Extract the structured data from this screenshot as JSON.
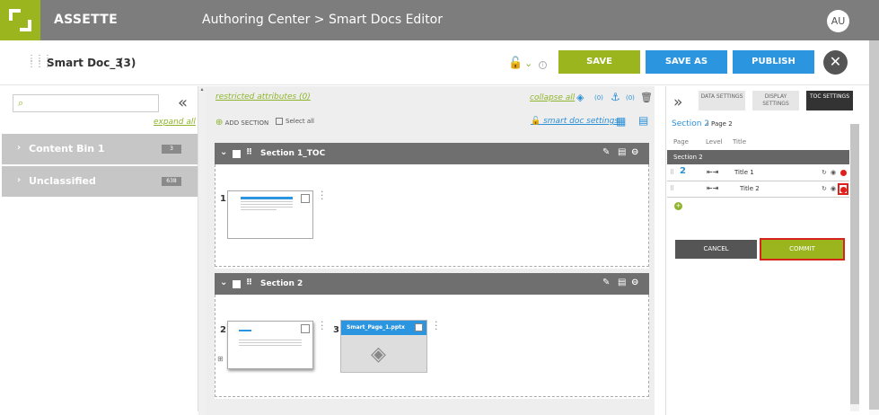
{
  "app": {
    "brand": "ASSETTE",
    "breadcrumb": "Authoring Center > Smart Docs Editor",
    "user_initials": "AU"
  },
  "toolbar": {
    "doc_title": "Smart Doc_3",
    "doc_count": "(3)",
    "save": "SAVE",
    "save_as": "SAVE AS",
    "publish": "PUBLISH",
    "close_glyph": "✕"
  },
  "colors": {
    "accent_green": "#9ab51e",
    "accent_blue": "#2b95e0",
    "highlight_red": "#e0201a",
    "header_gray": "#7d7d7d"
  },
  "left": {
    "search_placeholder": "",
    "expand_all": "expand all",
    "bins": [
      {
        "label": "Content Bin 1",
        "count": "3"
      },
      {
        "label": "Unclassified",
        "count": "638"
      }
    ]
  },
  "middle": {
    "restricted": "restricted attributes (0)",
    "collapse_all": "collapse all",
    "count_a": "(0)",
    "count_b": "(0)",
    "add_section": "ADD SECTION",
    "select_all": "Select all",
    "smart_doc_settings": "smart doc settings",
    "sections": [
      {
        "title": "Section 1_TOC",
        "pages": [
          {
            "num": "1"
          }
        ]
      },
      {
        "title": "Section 2",
        "pages": [
          {
            "num": "2"
          },
          {
            "num": "3",
            "name": "Smart_Page_1.pptx"
          }
        ]
      }
    ]
  },
  "right": {
    "tabs": [
      {
        "label": "DATA SETTINGS"
      },
      {
        "label": "DISPLAY SETTINGS"
      },
      {
        "label": "TOC SETTINGS"
      }
    ],
    "crumb_link": "Section 2",
    "crumb_current": "Page 2",
    "columns": {
      "page": "Page",
      "level": "Level",
      "title": "Title"
    },
    "section_label": "Section 2",
    "rows": [
      {
        "page": "2",
        "title": "Title 1"
      },
      {
        "page": "",
        "title": "Title 2"
      }
    ],
    "cancel": "CANCEL",
    "commit": "COMMIT"
  }
}
